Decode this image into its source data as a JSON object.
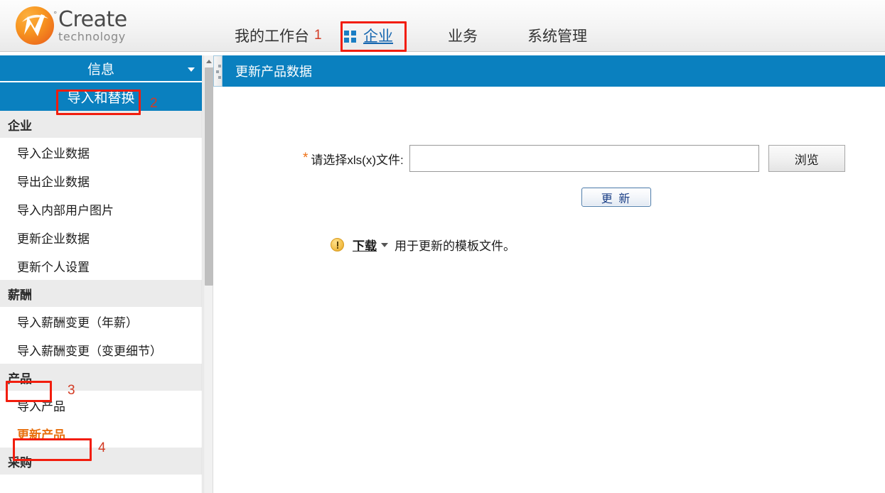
{
  "brand": {
    "name": "Create",
    "tagline": "technology",
    "registered_mark": "°"
  },
  "nav": {
    "items": [
      {
        "label": "我的工作台",
        "badge": "1",
        "active": false,
        "icon": null
      },
      {
        "label": "企业",
        "badge": null,
        "active": true,
        "icon": "grid-icon"
      },
      {
        "label": "业务",
        "badge": null,
        "active": false,
        "icon": null
      },
      {
        "label": "系统管理",
        "badge": null,
        "active": false,
        "icon": null
      }
    ],
    "annotation_1": "1"
  },
  "sidebar": {
    "header": "信息",
    "current": "导入和替换",
    "annotation_2": "2",
    "groups": [
      {
        "title": "企业",
        "items": [
          "导入企业数据",
          "导出企业数据",
          "导入内部用户图片",
          "更新企业数据",
          "更新个人设置"
        ]
      },
      {
        "title": "薪酬",
        "items": [
          "导入薪酬变更（年薪）",
          "导入薪酬变更（变更细节）"
        ]
      },
      {
        "title": "产品",
        "annotation": "3",
        "items": [
          "导入产品",
          "更新产品"
        ],
        "selected_item": "更新产品",
        "item_annotation": "4"
      },
      {
        "title": "采购",
        "items": []
      }
    ]
  },
  "content": {
    "header_title": "更新产品数据",
    "form": {
      "required_mark": "*",
      "file_label": "请选择xls(x)文件:",
      "file_value": "",
      "file_placeholder": "",
      "browse_label": "浏览",
      "submit_label": "更 新"
    },
    "download": {
      "link_label": "下载",
      "description": "用于更新的模板文件。"
    }
  },
  "colors": {
    "brand_blue": "#0a80bf",
    "nav_active": "#1767b0",
    "annotation_red": "#f21d0d",
    "annotation_num": "#d33b24",
    "selected_item_orange": "#e8700f",
    "required_star": "#ee7014",
    "section_bg": "#ebebeb"
  }
}
